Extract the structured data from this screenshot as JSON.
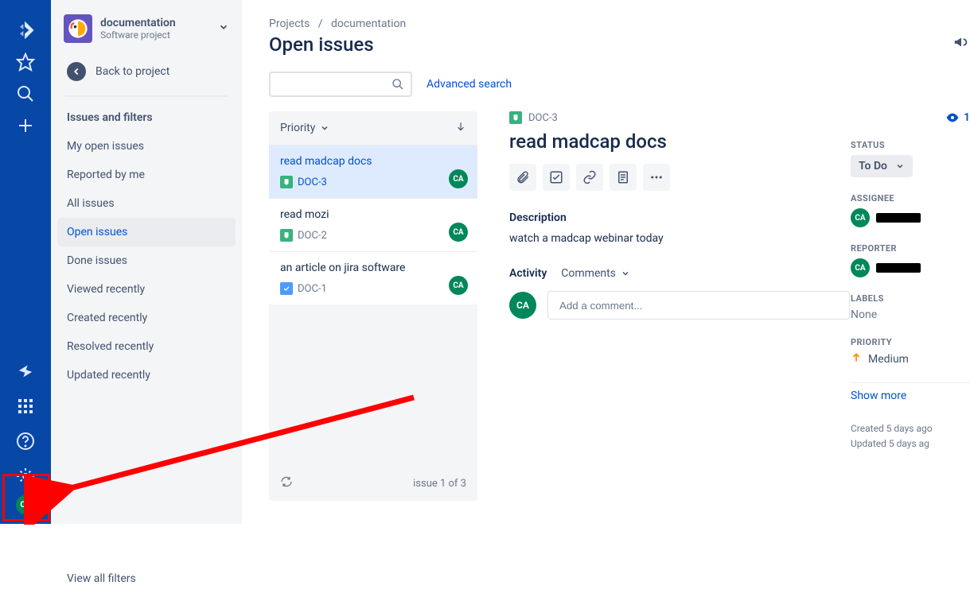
{
  "rail": {
    "avatar": "CA"
  },
  "sidebar": {
    "project_name": "documentation",
    "project_type": "Software project",
    "back_label": "Back to project",
    "section_label": "Issues and filters",
    "filters": [
      {
        "label": "My open issues"
      },
      {
        "label": "Reported by me"
      },
      {
        "label": "All issues"
      },
      {
        "label": "Open issues"
      },
      {
        "label": "Done issues"
      },
      {
        "label": "Viewed recently"
      },
      {
        "label": "Created recently"
      },
      {
        "label": "Resolved recently"
      },
      {
        "label": "Updated recently"
      }
    ],
    "selected_filter_index": 3,
    "view_all": "View all filters"
  },
  "breadcrumbs": {
    "root": "Projects",
    "project": "documentation"
  },
  "page_title": "Open issues",
  "search": {
    "advanced": "Advanced search"
  },
  "list": {
    "sort_label": "Priority",
    "issues": [
      {
        "title": "read madcap docs",
        "key": "DOC-3",
        "type": "story",
        "avatar": "CA",
        "selected": true
      },
      {
        "title": "read mozi",
        "key": "DOC-2",
        "type": "story",
        "avatar": "CA",
        "selected": false
      },
      {
        "title": "an article on jira software",
        "key": "DOC-1",
        "type": "task",
        "avatar": "CA",
        "selected": false
      }
    ],
    "footer_text": "issue 1 of 3"
  },
  "detail": {
    "key": "DOC-3",
    "title": "read madcap docs",
    "description_label": "Description",
    "description": "watch a madcap webinar today",
    "activity_label": "Activity",
    "activity_tab": "Comments",
    "comment_placeholder": "Add a comment...",
    "comment_avatar": "CA"
  },
  "side": {
    "watch_count": "1",
    "status_label": "STATUS",
    "status_value": "To Do",
    "assignee_label": "ASSIGNEE",
    "assignee_avatar": "CA",
    "reporter_label": "REPORTER",
    "reporter_avatar": "CA",
    "labels_label": "LABELS",
    "labels_value": "None",
    "priority_label": "PRIORITY",
    "priority_value": "Medium",
    "show_more": "Show more",
    "created": "Created 5 days ago",
    "updated": "Updated 5 days ag"
  }
}
